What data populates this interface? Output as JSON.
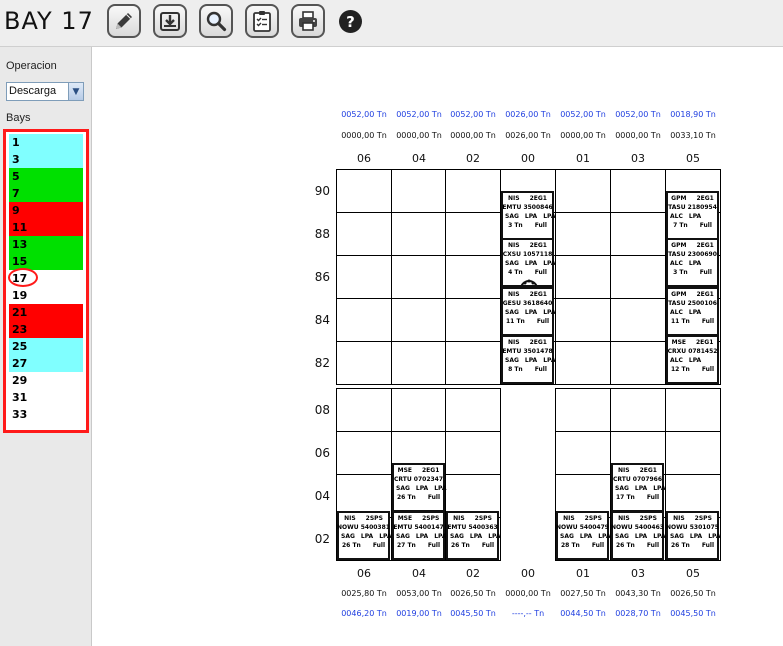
{
  "toolbar": {
    "title": "BAY 17",
    "buttons": [
      {
        "icon": "pencil-icon"
      },
      {
        "icon": "download-tray-icon"
      },
      {
        "icon": "magnifier-icon"
      },
      {
        "icon": "clipboard-check-icon"
      },
      {
        "icon": "printer-icon"
      }
    ],
    "help_label": "?"
  },
  "sidebar": {
    "operation_label": "Operacion",
    "operation_value": "Descarga",
    "bays_label": "Bays",
    "selected_bay": "17",
    "bay_groups": [
      {
        "bays": [
          "1",
          "3"
        ],
        "color": "#80ffff"
      },
      {
        "bays": [
          "5",
          "7"
        ],
        "color": "#00e000"
      },
      {
        "bays": [
          "9",
          "11"
        ],
        "color": "#ff0000"
      },
      {
        "bays": [
          "13",
          "15"
        ],
        "color": "#00e000"
      },
      {
        "bays": [
          "17",
          "19"
        ],
        "color": "#ffffff"
      },
      {
        "bays": [
          "21",
          "23"
        ],
        "color": "#ff0000"
      },
      {
        "bays": [
          "25",
          "27"
        ],
        "color": "#80ffff"
      },
      {
        "bays": [
          "29",
          "31",
          "33"
        ],
        "color": "#ffffff"
      }
    ]
  },
  "plan": {
    "columns": [
      "06",
      "04",
      "02",
      "00",
      "01",
      "03",
      "05"
    ],
    "top_weights_1": [
      "0052,00 Tn",
      "0052,00 Tn",
      "0052,00 Tn",
      "0026,00 Tn",
      "0052,00 Tn",
      "0052,00 Tn",
      "0018,90 Tn"
    ],
    "top_weights_2": [
      "0000,00 Tn",
      "0000,00 Tn",
      "0000,00 Tn",
      "0026,00 Tn",
      "0000,00 Tn",
      "0000,00 Tn",
      "0033,10 Tn"
    ],
    "bottom_weights_1": [
      "0025,80 Tn",
      "0053,00 Tn",
      "0026,50 Tn",
      "0000,00 Tn",
      "0027,50 Tn",
      "0043,30 Tn",
      "0026,50 Tn"
    ],
    "bottom_weights_2": [
      "0046,20 Tn",
      "0019,00 Tn",
      "0045,50 Tn",
      "----,-- Tn",
      "0044,50 Tn",
      "0028,70 Tn",
      "0045,50 Tn"
    ],
    "deck_tiers": [
      "90",
      "88",
      "86",
      "84",
      "82"
    ],
    "hold_tiers": [
      "08",
      "06",
      "04",
      "02"
    ],
    "deck_containers": [
      {
        "col": 3,
        "tier": 0,
        "lines": [
          [
            "NIS",
            "2EG1"
          ],
          [
            "EMTU 3500846"
          ],
          [
            "SAG",
            "LPA",
            "LPA"
          ],
          [
            "3 Tn",
            "Full"
          ]
        ]
      },
      {
        "col": 3,
        "tier": 1,
        "lines": [
          [
            "NIS",
            "2EG1"
          ],
          [
            "CXSU 1057118"
          ],
          [
            "SAG",
            "LPA",
            "LPA"
          ],
          [
            "4 Tn",
            "Full"
          ]
        ]
      },
      {
        "col": 3,
        "tier": 2,
        "lines": [
          [
            "NIS",
            "2EG1"
          ],
          [
            "GESU 3618640"
          ],
          [
            "SAG",
            "LPA",
            "LPA"
          ],
          [
            "11 Tn",
            "Full"
          ]
        ]
      },
      {
        "col": 3,
        "tier": 3,
        "lines": [
          [
            "NIS",
            "2EG1"
          ],
          [
            "EMTU 3501478"
          ],
          [
            "SAG",
            "LPA",
            "LPA"
          ],
          [
            "8 Tn",
            "Full"
          ]
        ]
      },
      {
        "col": 6,
        "tier": 0,
        "lines": [
          [
            "GPM",
            "2EG1"
          ],
          [
            "TASU 2180954"
          ],
          [
            "ALC",
            "LPA"
          ],
          [
            "7 Tn",
            "Full"
          ]
        ]
      },
      {
        "col": 6,
        "tier": 1,
        "lines": [
          [
            "GPM",
            "2EG1"
          ],
          [
            "TASU 2300690"
          ],
          [
            "ALC",
            "LPA"
          ],
          [
            "3 Tn",
            "Full"
          ]
        ]
      },
      {
        "col": 6,
        "tier": 2,
        "lines": [
          [
            "GPM",
            "2EG1"
          ],
          [
            "TASU 2500106"
          ],
          [
            "ALC",
            "LPA"
          ],
          [
            "11 Tn",
            "Full"
          ]
        ]
      },
      {
        "col": 6,
        "tier": 3,
        "lines": [
          [
            "MSE",
            "2EG1"
          ],
          [
            "CRXU 0781452"
          ],
          [
            "ALC",
            "LPA"
          ],
          [
            "12 Tn",
            "Full"
          ]
        ]
      }
    ],
    "hold_containers": [
      {
        "col": 1,
        "tier": 1,
        "lines": [
          [
            "MSE",
            "2EG1"
          ],
          [
            "CRTU 0702347"
          ],
          [
            "SAG",
            "LPA",
            "LPA"
          ],
          [
            "26 Tn",
            "Full"
          ]
        ]
      },
      {
        "col": 5,
        "tier": 1,
        "lines": [
          [
            "NIS",
            "2EG1"
          ],
          [
            "CRTU 0707966"
          ],
          [
            "SAG",
            "LPA",
            "LPA"
          ],
          [
            "17 Tn",
            "Full"
          ]
        ]
      },
      {
        "col": 0,
        "tier": 0,
        "lines": [
          [
            "NIS",
            "2SPS"
          ],
          [
            "NOWU 5400381"
          ],
          [
            "SAG",
            "LPA",
            "LPA"
          ],
          [
            "26 Tn",
            "Full"
          ]
        ]
      },
      {
        "col": 1,
        "tier": 0,
        "lines": [
          [
            "MSE",
            "2SPS"
          ],
          [
            "EMTU 5400147"
          ],
          [
            "SAG",
            "LPA",
            "LPA"
          ],
          [
            "27 Tn",
            "Full"
          ]
        ]
      },
      {
        "col": 2,
        "tier": 0,
        "lines": [
          [
            "NIS",
            "2SPS"
          ],
          [
            "EMTU 5400363"
          ],
          [
            "SAG",
            "LPA",
            "LPA"
          ],
          [
            "26 Tn",
            "Full"
          ]
        ]
      },
      {
        "col": 4,
        "tier": 0,
        "lines": [
          [
            "NIS",
            "2SPS"
          ],
          [
            "NOWU 5400479"
          ],
          [
            "SAG",
            "LPA",
            "LPA"
          ],
          [
            "28 Tn",
            "Full"
          ]
        ]
      },
      {
        "col": 5,
        "tier": 0,
        "lines": [
          [
            "NIS",
            "2SPS"
          ],
          [
            "NOWU 5400463"
          ],
          [
            "SAG",
            "LPA",
            "LPA"
          ],
          [
            "26 Tn",
            "Full"
          ]
        ]
      },
      {
        "col": 6,
        "tier": 0,
        "lines": [
          [
            "NIS",
            "2SPS"
          ],
          [
            "NOWU 5301075"
          ],
          [
            "SAG",
            "LPA",
            "LPA"
          ],
          [
            "26 Tn",
            "Full"
          ]
        ]
      }
    ],
    "hook_icon": "crane-hook-icon"
  }
}
